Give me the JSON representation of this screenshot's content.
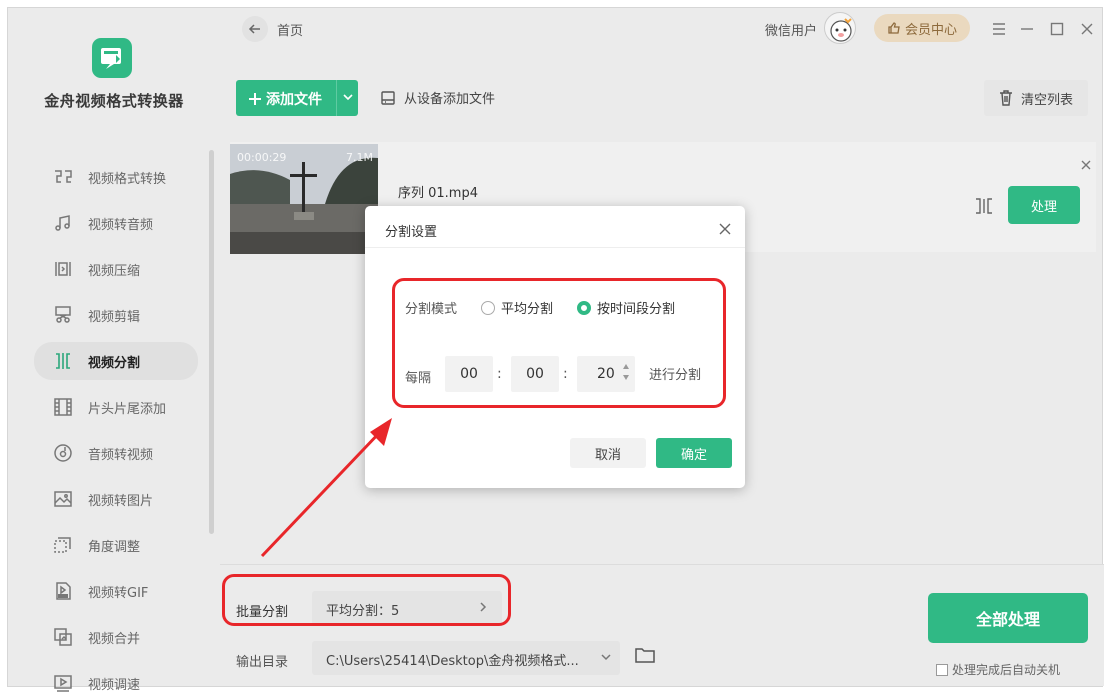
{
  "app": {
    "title": "金舟视频格式转换器"
  },
  "sidebar": {
    "items": [
      {
        "label": "视频格式转换",
        "icon": "format-convert-icon"
      },
      {
        "label": "视频转音频",
        "icon": "music-note-icon"
      },
      {
        "label": "视频压缩",
        "icon": "compress-icon"
      },
      {
        "label": "视频剪辑",
        "icon": "scissors-icon"
      },
      {
        "label": "视频分割",
        "icon": "split-icon",
        "active": true
      },
      {
        "label": "片头片尾添加",
        "icon": "film-strip-icon"
      },
      {
        "label": "音频转视频",
        "icon": "disc-icon"
      },
      {
        "label": "视频转图片",
        "icon": "image-icon"
      },
      {
        "label": "角度调整",
        "icon": "rotate-icon"
      },
      {
        "label": "视频转GIF",
        "icon": "gif-icon"
      },
      {
        "label": "视频合并",
        "icon": "merge-icon"
      },
      {
        "label": "视频调速",
        "icon": "speed-icon"
      }
    ]
  },
  "header": {
    "breadcrumb": "首页",
    "user_name": "微信用户",
    "vip_label": "会员中心"
  },
  "toolbar": {
    "add_file_label": "添加文件",
    "add_from_device_label": "从设备添加文件",
    "clear_list_label": "清空列表"
  },
  "file": {
    "duration": "00:00:29",
    "size": "7.1M",
    "name": "序列 01.mp4",
    "process_label": "处理"
  },
  "bottom": {
    "batch_label": "批量分割",
    "batch_value": "平均分割：5",
    "output_label": "输出目录",
    "output_path": "C:\\Users\\25414\\Desktop\\金舟视频格式...",
    "process_all_label": "全部处理",
    "auto_shutdown_label": "处理完成后自动关机"
  },
  "dialog": {
    "title": "分割设置",
    "mode_label": "分割模式",
    "option_even": "平均分割",
    "option_time": "按时间段分割",
    "selected": "按时间段分割",
    "every_label": "每隔",
    "hours": "00",
    "minutes": "00",
    "seconds": "20",
    "suffix": "进行分割",
    "cancel_label": "取消",
    "ok_label": "确定"
  },
  "colors": {
    "accent": "#30b985",
    "highlight": "#e8262a",
    "vip_bg": "#ead9bf"
  }
}
